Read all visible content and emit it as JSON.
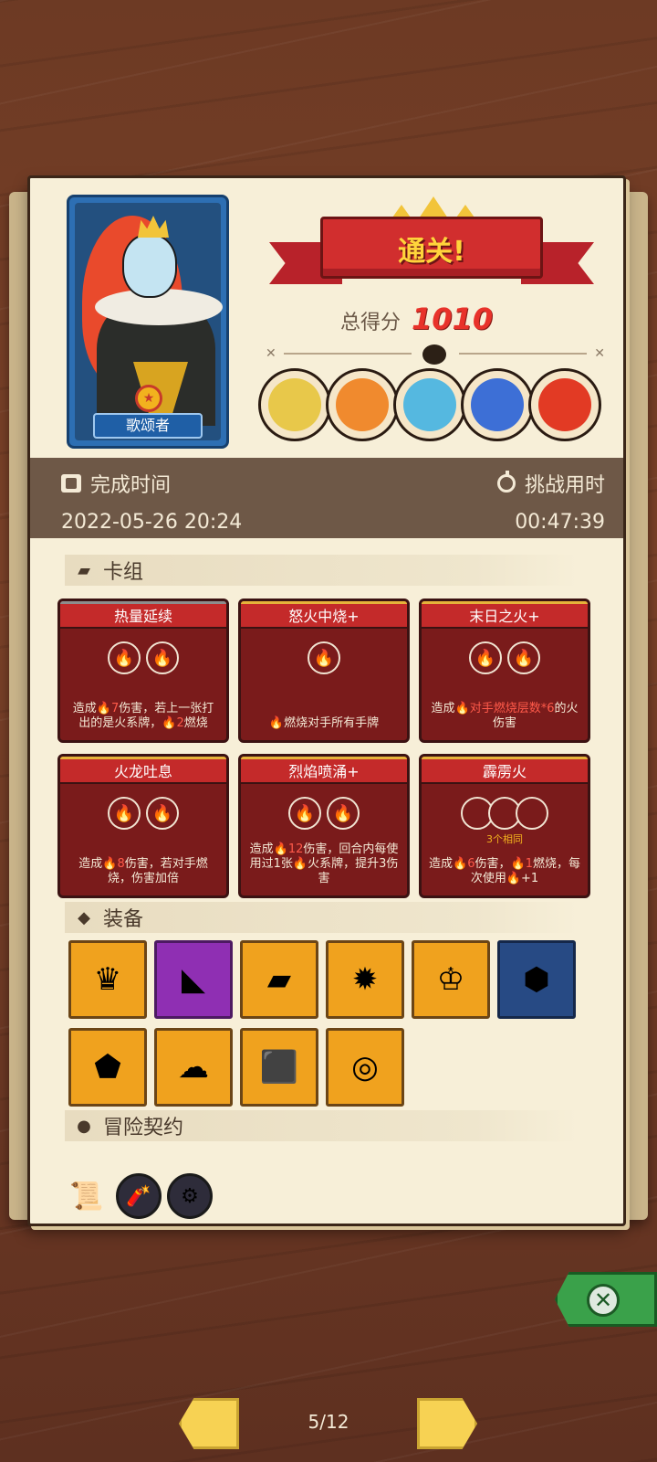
{
  "hero": {
    "name": "歌颂者"
  },
  "banner": {
    "title": "通关!"
  },
  "score": {
    "label": "总得分",
    "value": "1010"
  },
  "info": {
    "finish_label": "完成时间",
    "finish_value": "2022-05-26 20:24",
    "challenge_label": "挑战用时",
    "challenge_value": "00:47:39"
  },
  "sections": {
    "deck": "卡组",
    "equipment": "装备",
    "contracts": "冒险契约"
  },
  "cards": [
    {
      "title": "热量延续",
      "cost": 2,
      "desc_pre": "造成",
      "dmg": "7",
      "desc_mid": "伤害，若上一张打出的是火系牌，",
      "burn": "2",
      "desc_post": "燃烧"
    },
    {
      "title": "怒火中烧+",
      "cost": 1,
      "desc": "燃烧对手所有手牌"
    },
    {
      "title": "末日之火+",
      "cost": 2,
      "desc_pre": "造成",
      "highlight": "对手燃烧层数*6",
      "desc_post": "的火伤害"
    },
    {
      "title": "火龙吐息",
      "cost": 2,
      "desc_pre": "造成",
      "dmg": "8",
      "desc_post": "伤害，若对手燃烧，伤害加倍"
    },
    {
      "title": "烈焰喷涌+",
      "cost": 2,
      "desc_pre": "造成",
      "dmg": "12",
      "desc_mid": "伤害，回合内每使用过1张",
      "desc_post": "火系牌，提升3伤害"
    },
    {
      "title": "霹雳火",
      "cost": 3,
      "cost_note": "3个相同",
      "desc_pre": "造成",
      "dmg": "6",
      "desc_mid": "伤害，",
      "burn": "1",
      "desc_post": "燃烧，每次使用",
      "plus": "+1"
    }
  ],
  "equipment_icons": [
    "crown-icon",
    "cheese-icon",
    "moss-block-icon",
    "fire-orb-icon",
    "ruby-crown-icon",
    "fire-gem-ring-icon",
    "ice-shield-icon",
    "ghost-slime-icon",
    "fire-dice-icon",
    "target-disc-icon"
  ],
  "contract_icons": [
    "scroll-icon",
    "dynamite-icon",
    "gear-helmet-icon"
  ],
  "boss_colors": [
    "#e8c84a",
    "#f08a2e",
    "#55b8e0",
    "#3d6fd6",
    "#e23a24"
  ],
  "pager": {
    "current": "5/12"
  }
}
